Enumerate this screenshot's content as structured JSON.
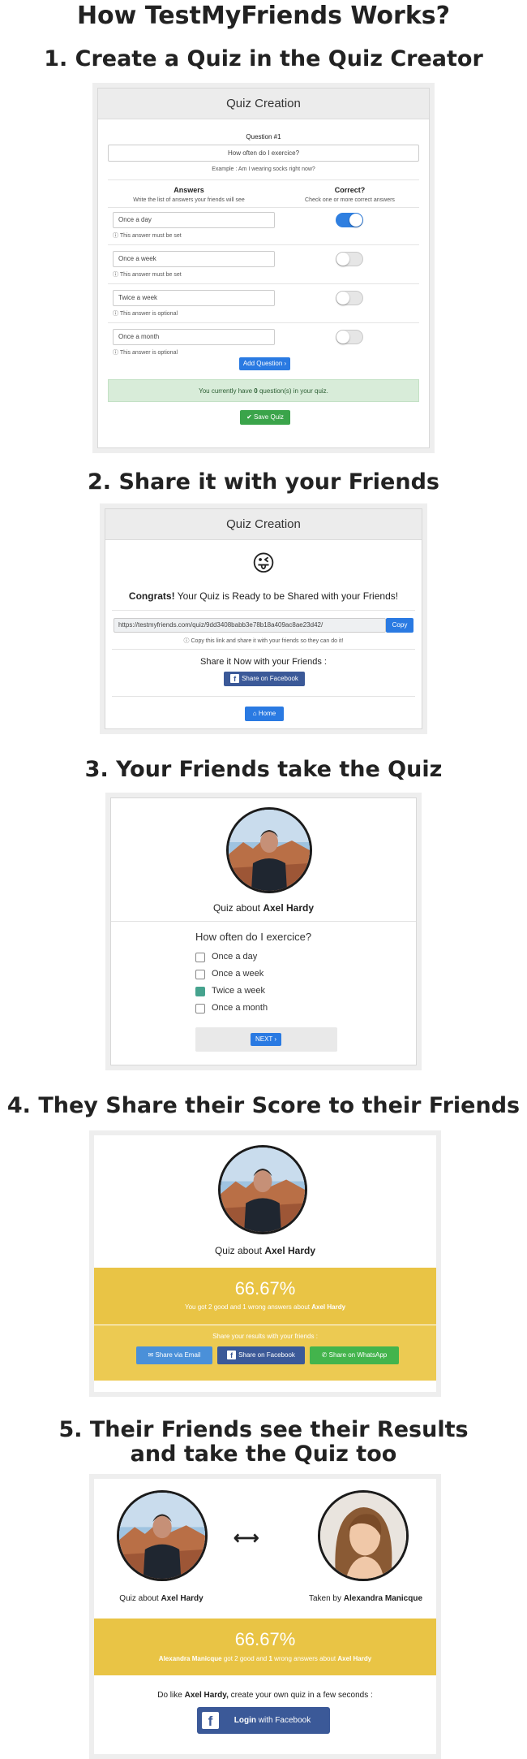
{
  "page": {
    "main_title": "How TestMyFriends Works?",
    "steps": [
      "1. Create a Quiz in the Quiz Creator",
      "2. Share it with your Friends",
      "3. Your Friends take the Quiz",
      "4. They Share their Score to their Friends",
      "5. Their Friends see their Results",
      "and take the Quiz too"
    ]
  },
  "step1": {
    "header": "Quiz Creation",
    "question_label": "Question #1",
    "question_value": "How often do I exercice?",
    "question_example": "Example : Am I wearing socks right now?",
    "answers_heading": "Answers",
    "answers_sub": "Write the list of answers your friends will see",
    "correct_heading": "Correct?",
    "correct_sub": "Check one or more correct answers",
    "answers": [
      {
        "text": "Once a day",
        "note": "This answer must be set",
        "correct": true
      },
      {
        "text": "Once a week",
        "note": "This answer must be set",
        "correct": false
      },
      {
        "text": "Twice a week",
        "note": "This answer is optional",
        "correct": false
      },
      {
        "text": "Once a month",
        "note": "This answer is optional",
        "correct": false
      }
    ],
    "add_question": "Add Question",
    "status_pre": "You currently have ",
    "status_count": "0",
    "status_post": " question(s) in your quiz.",
    "save_quiz": "Save Quiz"
  },
  "step2": {
    "header": "Quiz Creation",
    "emoji": "😜",
    "congrats_bold": "Congrats!",
    "congrats_rest": " Your Quiz is Ready to be Shared with your Friends!",
    "link": "https://testmyfriends.com/quiz/9dd3408babb3e78b18a409ac8ae23d42/",
    "copy": "Copy",
    "copy_hint": "Copy this link and share it with your friends so they can do it!",
    "share_now": "Share it Now with your Friends :",
    "share_fb": "Share on Facebook",
    "home": "Home"
  },
  "step3": {
    "quiz_about_pre": "Quiz about ",
    "name": "Axel Hardy",
    "question": "How often do I exercice?",
    "options": [
      {
        "text": "Once a day",
        "checked": false
      },
      {
        "text": "Once a week",
        "checked": false
      },
      {
        "text": "Twice a week",
        "checked": true
      },
      {
        "text": "Once a month",
        "checked": false
      }
    ],
    "next": "NEXT"
  },
  "step4": {
    "quiz_about_pre": "Quiz about ",
    "name": "Axel Hardy",
    "score": "66.67%",
    "result_pre": "You got 2 good and 1 wrong answers about ",
    "result_name": "Axel Hardy",
    "share_results": "Share your results with your friends :",
    "share_email": "Share via Email",
    "share_fb": "Share on Facebook",
    "share_wa": "Share on WhatsApp"
  },
  "step5": {
    "quiz_about_pre": "Quiz about ",
    "name": "Axel Hardy",
    "taken_by_pre": "Taken by ",
    "taker": "Alexandra Manicque",
    "score": "66.67%",
    "result_taker": "Alexandra Manicque",
    "result_mid": " got 2 good and ",
    "result_wrong": "1",
    "result_post": " wrong answers about ",
    "result_name": "Axel Hardy",
    "do_like_pre": "Do like ",
    "do_like_name": "Axel Hardy,",
    "do_like_post": " create your own quiz in a few seconds :",
    "login_pre": "Login",
    "login_post": " with Facebook"
  },
  "colors": {
    "accent_blue": "#2a7ae2",
    "success_green": "#3aa44a",
    "facebook": "#3b5998",
    "result_yellow": "#e9c445",
    "alert_green_bg": "#d8ecd9"
  }
}
